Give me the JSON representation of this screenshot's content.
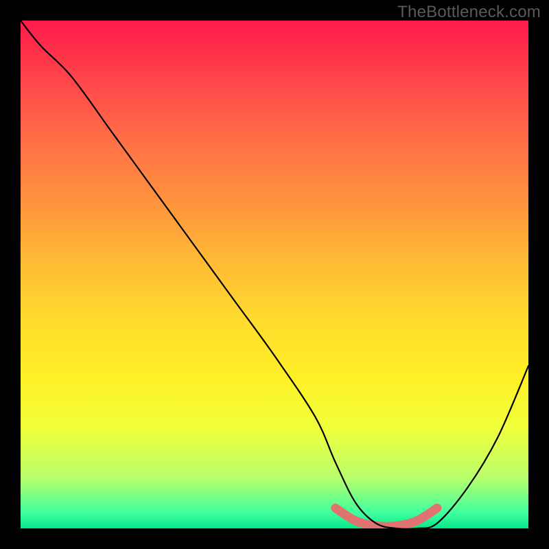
{
  "watermark": "TheBottleneck.com",
  "chart_data": {
    "type": "line",
    "title": "",
    "xlabel": "",
    "ylabel": "",
    "xlim": [
      0,
      100
    ],
    "ylim": [
      0,
      100
    ],
    "grid": false,
    "series": [
      {
        "name": "main-curve",
        "color": "#000000",
        "x": [
          0,
          4,
          10,
          18,
          26,
          34,
          42,
          50,
          58,
          62,
          66,
          70,
          74,
          78,
          82,
          88,
          94,
          100
        ],
        "y": [
          100,
          95,
          89,
          78,
          67,
          56,
          45,
          34,
          22,
          13,
          5,
          1,
          0,
          0,
          1,
          8,
          18,
          32
        ]
      },
      {
        "name": "highlight-band",
        "color": "#e0726f",
        "x": [
          62,
          66,
          70,
          74,
          78,
          82
        ],
        "y": [
          4,
          1.5,
          0.5,
          0.5,
          1.5,
          4
        ]
      }
    ],
    "gradient_stops": [
      {
        "pos": 0,
        "color": "#ff1a4b"
      },
      {
        "pos": 22,
        "color": "#ff6a47"
      },
      {
        "pos": 46,
        "color": "#ffb636"
      },
      {
        "pos": 70,
        "color": "#fff026"
      },
      {
        "pos": 90,
        "color": "#b8ff6b"
      },
      {
        "pos": 100,
        "color": "#06e88a"
      }
    ]
  }
}
